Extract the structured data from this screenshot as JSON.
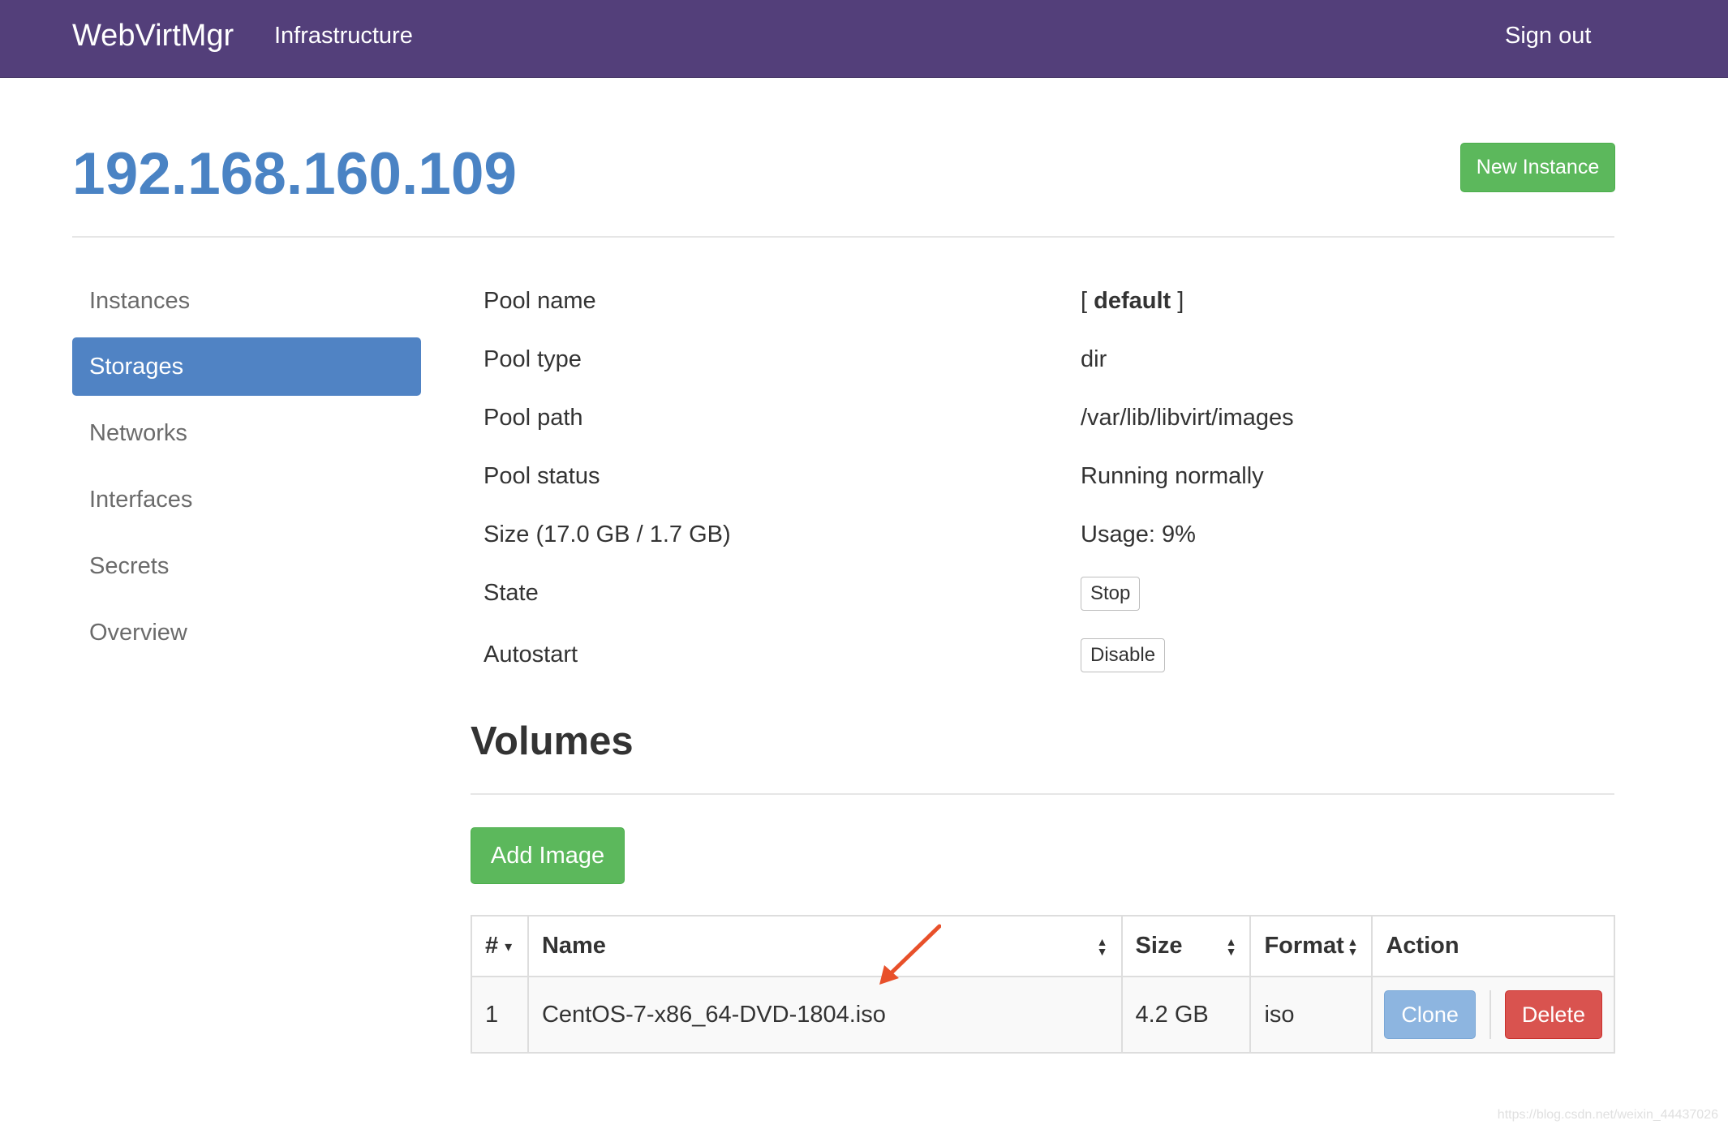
{
  "navbar": {
    "brand": "WebVirtMgr",
    "infrastructure": "Infrastructure",
    "sign_out": "Sign out"
  },
  "header": {
    "title": "192.168.160.109",
    "new_instance": "New Instance"
  },
  "sidebar": {
    "items": [
      {
        "label": "Instances",
        "active": false
      },
      {
        "label": "Storages",
        "active": true
      },
      {
        "label": "Networks",
        "active": false
      },
      {
        "label": "Interfaces",
        "active": false
      },
      {
        "label": "Secrets",
        "active": false
      },
      {
        "label": "Overview",
        "active": false
      }
    ]
  },
  "pool": {
    "name_label": "Pool name",
    "name_open": "[ ",
    "name_value": "default",
    "name_close": " ]",
    "type_label": "Pool type",
    "type_value": "dir",
    "path_label": "Pool path",
    "path_value": "/var/lib/libvirt/images",
    "status_label": "Pool status",
    "status_value": "Running normally",
    "size_label": "Size (17.0 GB / 1.7 GB)",
    "usage_value": "Usage: 9%",
    "state_label": "State",
    "state_button": "Stop",
    "autostart_label": "Autostart",
    "autostart_button": "Disable"
  },
  "volumes": {
    "title": "Volumes",
    "add_image": "Add Image",
    "columns": [
      "#",
      "Name",
      "Size",
      "Format",
      "Action"
    ],
    "rows": [
      {
        "num": "1",
        "name": "CentOS-7-x86_64-DVD-1804.iso",
        "size": "4.2 GB",
        "format": "iso",
        "clone": "Clone",
        "delete": "Delete"
      }
    ]
  },
  "watermark": "https://blog.csdn.net/weixin_44437026",
  "colors": {
    "navbar": "#533f7a",
    "title": "#4a83c4",
    "active": "#5083c4",
    "success": "#5cb85c",
    "danger": "#d9534f",
    "annotation_arrow": "#e8502a"
  }
}
